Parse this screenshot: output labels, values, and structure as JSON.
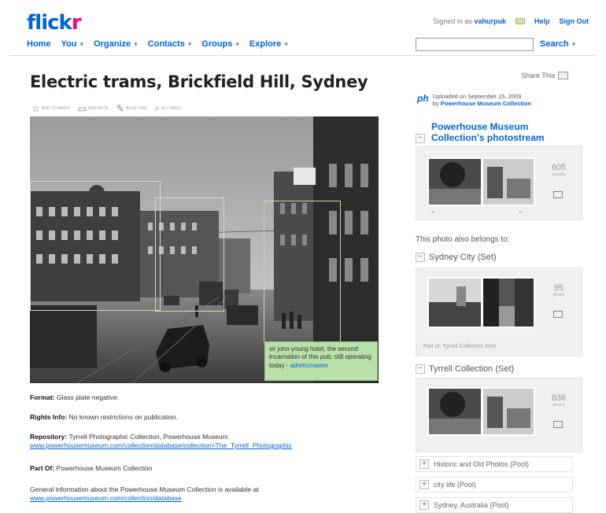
{
  "header": {
    "logo_main": "flick",
    "logo_r": "r",
    "signed_in_text": "Signed in as",
    "username": "vahurpuk",
    "help": "Help",
    "sign_out": "Sign Out"
  },
  "nav": {
    "items": [
      "Home",
      "You",
      "Organize",
      "Contacts",
      "Groups",
      "Explore"
    ],
    "search_label": "Search",
    "search_value": ""
  },
  "photo": {
    "title": "Electric trams, Brickfield Hill, Sydney",
    "share": "Share This",
    "actions": [
      "ADD TO FAVES",
      "ADD NOTE",
      "BLOG THIS",
      "ALL SIZES"
    ],
    "note_text": "sir john young hotel, the second incarnation of this pub, still operating today -",
    "note_user": "adnmcmaster"
  },
  "description": {
    "format_label": "Format:",
    "format_value": "Glass plate negative.",
    "rights_label": "Rights Info:",
    "rights_value": "No known restrictions on publication.",
    "repository_label": "Repository:",
    "repository_value": "Tyrrell Photographic Collection, Powerhouse Museum",
    "repository_link": "www.powerhousemuseum.com/collection/database/collection=The_Tyrrell_Photographic",
    "partof_label": "Part Of:",
    "partof_value": "Powerhouse Museum Collection",
    "general_text": "General information about the Powerhouse Museum Collection is available at",
    "general_link": "www.powerhousemuseum.com/collection/database"
  },
  "sidebar": {
    "uploaded_text": "Uploaded on September 15, 2009",
    "by_text": "by",
    "uploader": "Powerhouse Museum Collection",
    "photostream_title": "Powerhouse Museum Collection's photostream",
    "photostream_count": "605",
    "photostream_count_label": "uploads",
    "belongs_to": "This photo also belongs to:",
    "sets": [
      {
        "name": "Sydney City (Set)",
        "count": "95",
        "count_label": "photos",
        "part_of": "Part of: Tyrrell Collection Sets"
      },
      {
        "name": "Tyrrell Collection (Set)",
        "count": "836",
        "count_label": "photos"
      }
    ],
    "pools": [
      "Historic and Old Photos (Pool)",
      "city life (Pool)",
      "Sydney, Australia (Pool)"
    ]
  }
}
